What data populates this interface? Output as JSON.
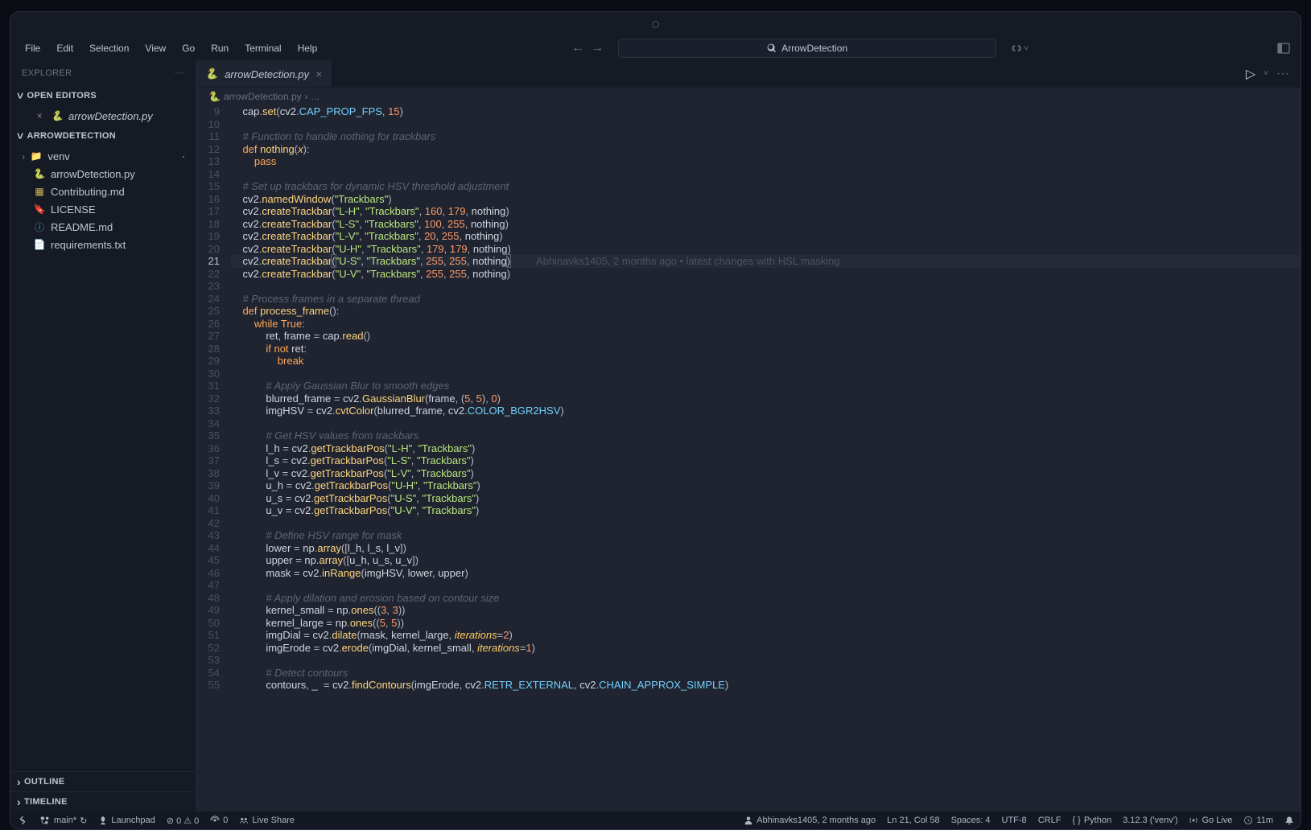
{
  "menubar": {
    "items": [
      "File",
      "Edit",
      "Selection",
      "View",
      "Go",
      "Run",
      "Terminal",
      "Help"
    ]
  },
  "search": {
    "placeholder": "ArrowDetection"
  },
  "explorer": {
    "title": "EXPLORER",
    "openEditors": {
      "label": "OPEN EDITORS",
      "items": [
        {
          "name": "arrowDetection.py",
          "icon": "python"
        }
      ]
    },
    "folder": {
      "label": "ARROWDETECTION",
      "items": [
        {
          "name": "venv",
          "icon": "folder",
          "chev": ">",
          "dot": true
        },
        {
          "name": "arrowDetection.py",
          "icon": "python"
        },
        {
          "name": "Contributing.md",
          "icon": "yellow-md"
        },
        {
          "name": "LICENSE",
          "icon": "cert"
        },
        {
          "name": "README.md",
          "icon": "info"
        },
        {
          "name": "requirements.txt",
          "icon": "txt"
        }
      ]
    },
    "outline": "OUTLINE",
    "timeline": "TIMELINE"
  },
  "tab": {
    "name": "arrowDetection.py"
  },
  "breadcrumb": {
    "file": "arrowDetection.py",
    "more": "..."
  },
  "gutter": {
    "start": 9,
    "end": 55,
    "active": 21
  },
  "blame": "Abhinavks1405, 2 months ago • latest changes with HSL masking",
  "code": {
    "l9": {
      "indent": "    ",
      "a": "cap",
      "b": ".set(",
      "c": "cv2",
      "d": ".CAP_PROP_FPS",
      "e": ",",
      "f": "15",
      "g": ")"
    },
    "l11": "    # Function to handle nothing for trackbars",
    "l12": {
      "k": "def ",
      "f": "nothing",
      "p": "(",
      "x": "x",
      "r": "):"
    },
    "l13": {
      "i": "        ",
      "k": "pass"
    },
    "l15": "    # Set up trackbars for dynamic HSV threshold adjustment",
    "l16": {
      "a": "cv2",
      "b": ".namedWindow(",
      "s": "\"Trackbars\"",
      "c": ")"
    },
    "l17": {
      "a": "cv2",
      "b": ".createTrackbar(",
      "s1": "\"L-H\"",
      "c": ", ",
      "s2": "\"Trackbars\"",
      "d": ", ",
      "n1": "160",
      "e": ", ",
      "n2": "179",
      "f": ", ",
      "v": "nothing",
      "g": ")"
    },
    "l18": {
      "a": "cv2",
      "b": ".createTrackbar(",
      "s1": "\"L-S\"",
      "c": ", ",
      "s2": "\"Trackbars\"",
      "d": ", ",
      "n1": "100",
      "e": ", ",
      "n2": "255",
      "f": ", ",
      "v": "nothing",
      "g": ")"
    },
    "l19": {
      "a": "cv2",
      "b": ".createTrackbar(",
      "s1": "\"L-V\"",
      "c": ", ",
      "s2": "\"Trackbars\"",
      "d": ", ",
      "n1": "20",
      "e": ", ",
      "n2": "255",
      "f": ", ",
      "v": "nothing",
      "g": ")"
    },
    "l20": {
      "a": "cv2",
      "b": ".createTrackbar(",
      "s1": "\"U-H\"",
      "c": ", ",
      "s2": "\"Trackbars\"",
      "d": ", ",
      "n1": "179",
      "e": ", ",
      "n2": "179",
      "f": ", ",
      "v": "nothing",
      "g": ")"
    },
    "l21": {
      "a": "cv2",
      "b": ".createTrackbar",
      "p": "(",
      "s1": "\"U-S\"",
      "c": ", ",
      "s2": "\"Trackbars\"",
      "d": ", ",
      "n1": "255",
      "e": ", ",
      "n2": "255",
      "f": ", ",
      "v": "nothing",
      "g": ")"
    },
    "l22": {
      "a": "cv2",
      "b": ".createTrackbar(",
      "s1": "\"U-V\"",
      "c": ", ",
      "s2": "\"Trackbars\"",
      "d": ", ",
      "n1": "255",
      "e": ", ",
      "n2": "255",
      "f": ", ",
      "v": "nothing",
      "g": ")"
    },
    "l24": "    # Process frames in a separate thread",
    "l25": {
      "k": "def ",
      "f": "process_frame",
      "p": "():"
    },
    "l26": {
      "i": "        ",
      "k": "while ",
      "b": "True",
      "c": ":"
    },
    "l27": {
      "i": "            ",
      "a": "ret, frame = cap",
      "b": ".read()"
    },
    "l28": {
      "i": "            ",
      "k": "if ",
      "n": "not ",
      "v": "ret",
      "c": ":"
    },
    "l29": {
      "i": "                ",
      "k": "break"
    },
    "l31": "            # Apply Gaussian Blur to smooth edges",
    "l32": {
      "i": "            ",
      "a": "blurred_frame = cv2",
      "b": ".GaussianBlur(",
      "c": "frame, (",
      "n1": "5",
      "d": ", ",
      "n2": "5",
      "e": "), ",
      "n3": "0",
      "f": ")"
    },
    "l33": {
      "i": "            ",
      "a": "imgHSV = cv2",
      "b": ".cvtColor(",
      "c": "blurred_frame, cv2",
      "d": ".COLOR_BGR2HSV)"
    },
    "l35": "            # Get HSV values from trackbars",
    "l36": {
      "i": "            ",
      "a": "l_h = cv2",
      "b": ".getTrackbarPos(",
      "s1": "\"L-H\"",
      "c": ", ",
      "s2": "\"Trackbars\"",
      "d": ")"
    },
    "l37": {
      "i": "            ",
      "a": "l_s = cv2",
      "b": ".getTrackbarPos(",
      "s1": "\"L-S\"",
      "c": ", ",
      "s2": "\"Trackbars\"",
      "d": ")"
    },
    "l38": {
      "i": "            ",
      "a": "l_v = cv2",
      "b": ".getTrackbarPos(",
      "s1": "\"L-V\"",
      "c": ", ",
      "s2": "\"Trackbars\"",
      "d": ")"
    },
    "l39": {
      "i": "            ",
      "a": "u_h = cv2",
      "b": ".getTrackbarPos(",
      "s1": "\"U-H\"",
      "c": ", ",
      "s2": "\"Trackbars\"",
      "d": ")"
    },
    "l40": {
      "i": "            ",
      "a": "u_s = cv2",
      "b": ".getTrackbarPos(",
      "s1": "\"U-S\"",
      "c": ", ",
      "s2": "\"Trackbars\"",
      "d": ")"
    },
    "l41": {
      "i": "            ",
      "a": "u_v = cv2",
      "b": ".getTrackbarPos(",
      "s1": "\"U-V\"",
      "c": ", ",
      "s2": "\"Trackbars\"",
      "d": ")"
    },
    "l43": "            # Define HSV range for mask",
    "l44": {
      "i": "            ",
      "a": "lower = np",
      "b": ".array([",
      "c": "l_h, l_s, l_v",
      "d": "])"
    },
    "l45": {
      "i": "            ",
      "a": "upper = np",
      "b": ".array([",
      "c": "u_h, u_s, u_v",
      "d": "])"
    },
    "l46": {
      "i": "            ",
      "a": "mask = cv2",
      "b": ".inRange(",
      "c": "imgHSV, lower, upper)"
    },
    "l48": "            # Apply dilation and erosion based on contour size",
    "l49": {
      "i": "            ",
      "a": "kernel_small = np",
      "b": ".ones((",
      "n1": "3",
      "c": ", ",
      "n2": "3",
      "d": "))"
    },
    "l50": {
      "i": "            ",
      "a": "kernel_large = np",
      "b": ".ones((",
      "n1": "5",
      "c": ", ",
      "n2": "5",
      "d": "))"
    },
    "l51": {
      "i": "            ",
      "a": "imgDial = cv2",
      "b": ".dilate(",
      "c": "mask, kernel_large, ",
      "p": "iterations",
      "e": "=",
      "n": "2",
      "f": ")"
    },
    "l52": {
      "i": "            ",
      "a": "imgErode = cv2",
      "b": ".erode(",
      "c": "imgDial, kernel_small, ",
      "p": "iterations",
      "e": "=",
      "n": "1",
      "f": ")"
    },
    "l54": "            # Detect contours",
    "l55": {
      "i": "            ",
      "a": "contours, _  = cv2",
      "b": ".findContours(",
      "c": "imgErode, cv2",
      "d": ".RETR_EXTERNAL, ",
      "e": "cv2",
      "f": ".CHAIN_APPROX_SIMPLE)"
    }
  },
  "status": {
    "branch": "main*",
    "sync": "↻",
    "launchpad": "Launchpad",
    "problems": "⊘ 0 ⚠ 0",
    "ports": "0",
    "liveshare": "Live Share",
    "blame": "Abhinavks1405, 2 months ago",
    "lncol": "Ln 21, Col 58",
    "spaces": "Spaces: 4",
    "encoding": "UTF-8",
    "eol": "CRLF",
    "lang": "Python",
    "interpreter": "3.12.3 ('venv')",
    "golive": "Go Live",
    "time": "11m"
  }
}
